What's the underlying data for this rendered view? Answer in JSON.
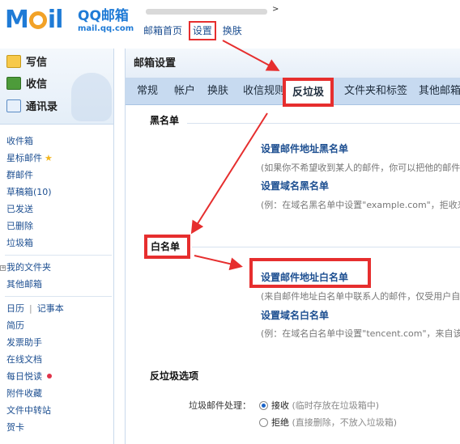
{
  "header": {
    "logo_mail": "M",
    "logo_tail": "il",
    "brand": "QQ邮箱",
    "domain": "mail.qq.com",
    "account_arrow": ">",
    "nav": [
      "邮箱首页",
      "设置",
      "换肤"
    ]
  },
  "sidebar": {
    "actions": [
      "写信",
      "收信",
      "通讯录"
    ],
    "folders": [
      "收件箱",
      "星标邮件",
      "群邮件",
      "草稿箱(10)",
      "已发送",
      "已删除",
      "垃圾箱"
    ],
    "my_folders": "我的文件夹",
    "other_mail": "其他邮箱",
    "calendar": "日历",
    "notes": "记事本",
    "tools": [
      "简历",
      "发票助手",
      "在线文档",
      "每日悦读",
      "附件收藏",
      "文件中转站",
      "贺卡"
    ]
  },
  "main": {
    "title": "邮箱设置",
    "tabs": [
      "常规",
      "帐户",
      "换肤",
      "收信规则",
      "反垃圾",
      "文件夹和标签",
      "其他邮箱"
    ],
    "blacklist": {
      "title": "黑名单",
      "address_link": "设置邮件地址黑名单",
      "address_desc": "(如果你不希望收到某人的邮件，你可以把他的邮件地",
      "domain_link": "设置域名黑名单",
      "domain_desc": "(例：在域名黑名单中设置\"example.com\"，拒收来"
    },
    "whitelist": {
      "title": "白名单",
      "address_link": "设置邮件地址白名单",
      "address_desc": "(来自邮件地址白名单中联系人的邮件，仅受用户自定",
      "domain_link": "设置域名白名单",
      "domain_desc": "(例：在域名白名单中设置\"tencent.com\"，来自该域"
    },
    "spam_options": {
      "title": "反垃圾选项",
      "label": "垃圾邮件处理：",
      "accept": "接收",
      "accept_note": "(临时存放在垃圾箱中)",
      "reject": "拒绝",
      "reject_note": "(直接删除，不放入垃圾箱)"
    }
  },
  "colors": {
    "annotation": "#e62e2e",
    "link": "#1d4f91",
    "tab_bar": "#c7daf0"
  }
}
